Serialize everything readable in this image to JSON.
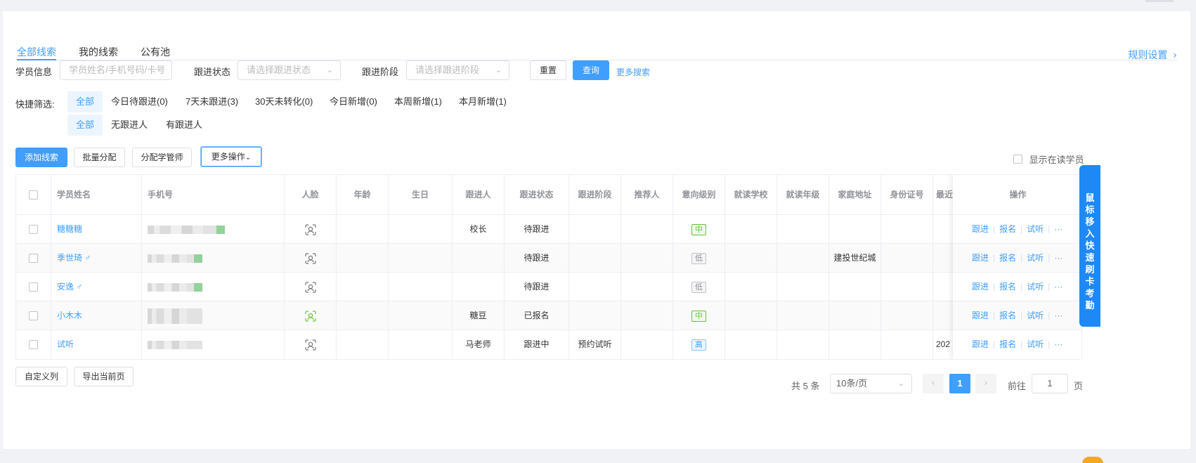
{
  "tabs": [
    {
      "label": "全部线索",
      "active": true
    },
    {
      "label": "我的线索",
      "active": false
    },
    {
      "label": "公有池",
      "active": false
    }
  ],
  "rule_link": "规则设置",
  "search": {
    "student_label": "学员信息",
    "student_placeholder": "学员姓名/手机号码/卡号",
    "status_label": "跟进状态",
    "status_placeholder": "请选择跟进状态",
    "stage_label": "跟进阶段",
    "stage_placeholder": "请选择跟进阶段",
    "reset": "重置",
    "query": "查询",
    "more": "更多搜索"
  },
  "quick_filter": {
    "label": "快捷筛选:",
    "row1": [
      "全部",
      "今日待跟进(0)",
      "7天未跟进(3)",
      "30天未转化(0)",
      "今日新增(0)",
      "本周新增(1)",
      "本月新增(1)"
    ],
    "row2": [
      "全部",
      "无跟进人",
      "有跟进人"
    ]
  },
  "actions": {
    "add": "添加线索",
    "batch": "批量分配",
    "assign": "分配学管师",
    "more": "更多操作",
    "show_reading": "显示在读学员"
  },
  "table": {
    "headers": [
      "学员姓名",
      "手机号",
      "人脸",
      "年龄",
      "生日",
      "跟进人",
      "跟进状态",
      "跟进阶段",
      "推荐人",
      "意向级别",
      "就读学校",
      "就读年级",
      "家庭地址",
      "身份证号",
      "最近"
    ],
    "op_header": "操作",
    "rows": [
      {
        "name": "糖糖糖",
        "follower": "校长",
        "status": "待跟进",
        "stage": "",
        "level": "中",
        "level_type": "mid",
        "address": "",
        "recent": ""
      },
      {
        "name": "季世琦 ♂",
        "follower": "",
        "status": "待跟进",
        "stage": "",
        "level": "低",
        "level_type": "low",
        "address": "建投世纪城",
        "recent": ""
      },
      {
        "name": "安逸 ♂",
        "follower": "",
        "status": "待跟进",
        "stage": "",
        "level": "低",
        "level_type": "low",
        "address": "",
        "recent": ""
      },
      {
        "name": "小木木",
        "follower": "糖豆",
        "status": "已报名",
        "stage": "",
        "level": "中",
        "level_type": "mid",
        "address": "",
        "recent": ""
      },
      {
        "name": "试听",
        "follower": "马老师",
        "status": "跟进中",
        "stage": "预约试听",
        "level": "高",
        "level_type": "high",
        "address": "",
        "recent": "202"
      }
    ],
    "ops": [
      "跟进",
      "报名",
      "试听",
      "···"
    ]
  },
  "bottom": {
    "custom_cols": "自定义列",
    "export": "导出当前页"
  },
  "pagination": {
    "total": "共 5 条",
    "page_size": "10条/页",
    "current": "1",
    "goto_label": "前往",
    "goto_value": "1",
    "page_unit": "页"
  },
  "side_float": "鼠标移入 快速刷卡考勤",
  "colors": {
    "primary": "#409eff",
    "float": "#1e88f5"
  }
}
